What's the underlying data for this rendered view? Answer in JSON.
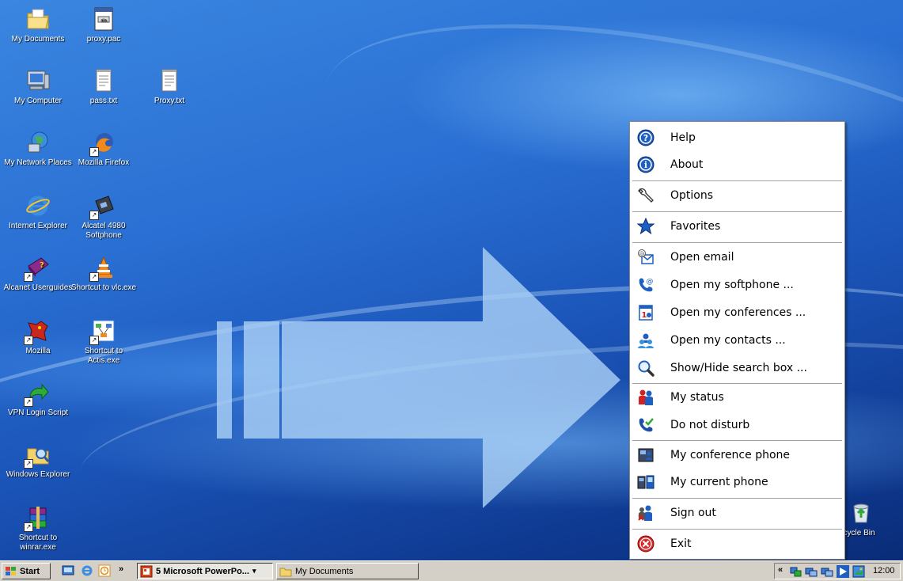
{
  "desktop": {
    "icons": [
      {
        "label": "My Documents",
        "icon": "my-documents-icon"
      },
      {
        "label": "proxy.pac",
        "icon": "pac-file-icon"
      },
      {
        "label": "My Computer",
        "icon": "my-computer-icon"
      },
      {
        "label": "pass.txt",
        "icon": "text-file-icon"
      },
      {
        "label": "Proxy.txt",
        "icon": "text-file-icon"
      },
      {
        "label": "My Network Places",
        "icon": "network-places-icon"
      },
      {
        "label": "Mozilla Firefox",
        "icon": "firefox-icon"
      },
      {
        "label": "Internet Explorer",
        "icon": "internet-explorer-icon"
      },
      {
        "label": "Alcatel 4980 Softphone",
        "icon": "softphone-icon"
      },
      {
        "label": "Alcanet Userguides",
        "icon": "help-book-icon"
      },
      {
        "label": "Shortcut to vlc.exe",
        "icon": "vlc-icon"
      },
      {
        "label": "Mozilla",
        "icon": "mozilla-icon"
      },
      {
        "label": "Shortcut to Actis.exe",
        "icon": "actis-icon"
      },
      {
        "label": "VPN Login Script",
        "icon": "script-arrow-icon"
      },
      {
        "label": "Windows Explorer",
        "icon": "windows-explorer-icon"
      },
      {
        "label": "Shortcut to winrar.exe",
        "icon": "winrar-icon"
      },
      {
        "label": "ecycle Bin",
        "icon": "recycle-bin-icon"
      }
    ]
  },
  "menu": {
    "items": [
      {
        "label": "Help",
        "icon": "help-icon"
      },
      {
        "label": "About",
        "icon": "info-icon"
      },
      {
        "label": "Options",
        "icon": "wrench-icon"
      },
      {
        "label": "Favorites",
        "icon": "star-icon"
      },
      {
        "label": "Open email",
        "icon": "email-icon"
      },
      {
        "label": "Open my softphone ...",
        "icon": "softphone-handset-icon"
      },
      {
        "label": "Open my conferences ...",
        "icon": "conference-icon"
      },
      {
        "label": "Open my contacts ...",
        "icon": "contacts-icon"
      },
      {
        "label": "Show/Hide search box ...",
        "icon": "magnifier-icon"
      },
      {
        "label": "My status",
        "icon": "status-people-icon"
      },
      {
        "label": "Do not disturb",
        "icon": "do-not-disturb-icon"
      },
      {
        "label": "My conference phone",
        "icon": "conference-phone-icon"
      },
      {
        "label": "My current phone",
        "icon": "current-phone-icon"
      },
      {
        "label": "Sign out",
        "icon": "sign-out-icon"
      },
      {
        "label": "Exit",
        "icon": "exit-icon"
      }
    ]
  },
  "taskbar": {
    "start_label": "Start",
    "overflow_label": "»",
    "tasks": [
      {
        "label": "5 Microsoft PowerPo...",
        "active": true
      },
      {
        "label": "My Documents",
        "active": false
      }
    ],
    "tray": {
      "expand_label": "«",
      "clock": "12:00"
    }
  },
  "colors": {
    "desktop_blue": "#2a6fd3",
    "arrow_fill": "#a9d0f5",
    "menu_bg": "#ffffff",
    "taskbar_bg": "#d4d0c8"
  }
}
